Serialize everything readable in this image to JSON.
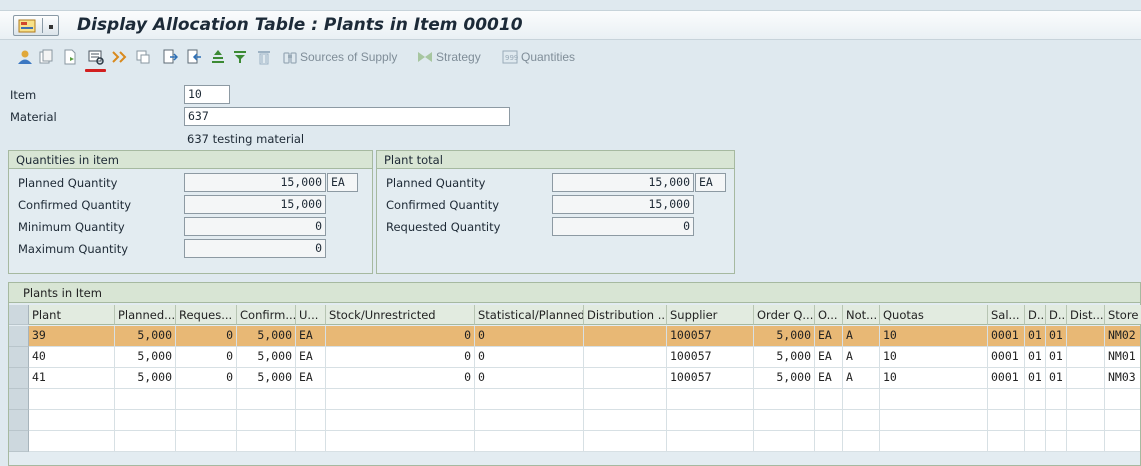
{
  "window": {
    "title": "Display Allocation Table : Plants in Item 00010"
  },
  "toolbar": {
    "sources_label": "Sources of Supply",
    "strategy_label": "Strategy",
    "quantities_label": "Quantities"
  },
  "header": {
    "item_label": "Item",
    "item_value": "10",
    "material_label": "Material",
    "material_value": "637",
    "material_desc": "637 testing material"
  },
  "qty_group": {
    "title": "Quantities in item",
    "planned_label": "Planned Quantity",
    "planned_value": "15,000",
    "planned_unit": "EA",
    "confirmed_label": "Confirmed Quantity",
    "confirmed_value": "15,000",
    "min_label": "Minimum Quantity",
    "min_value": "0",
    "max_label": "Maximum Quantity",
    "max_value": "0"
  },
  "plant_group": {
    "title": "Plant total",
    "planned_label": "Planned Quantity",
    "planned_value": "15,000",
    "planned_unit": "EA",
    "confirmed_label": "Confirmed Quantity",
    "confirmed_value": "15,000",
    "requested_label": "Requested Quantity",
    "requested_value": "0"
  },
  "table": {
    "title": "Plants in Item",
    "columns": [
      "Plant",
      "Planned...",
      "Reques...",
      "Confirm...",
      "U...",
      "Stock/Unrestricted",
      "Statistical/Planned",
      "Distribution ...",
      "Supplier",
      "Order Q...",
      "O...",
      "Not...",
      "Quotas",
      "Sal...",
      "D...",
      "D...",
      "Dist...",
      "Store"
    ],
    "rows": [
      [
        "39",
        "5,000",
        "0",
        "5,000",
        "EA",
        "0",
        "0",
        "",
        "100057",
        "5,000",
        "EA",
        "A",
        "10",
        "0001",
        "01",
        "01",
        "",
        "NM02"
      ],
      [
        "40",
        "5,000",
        "0",
        "5,000",
        "EA",
        "0",
        "0",
        "",
        "100057",
        "5,000",
        "EA",
        "A",
        "10",
        "0001",
        "01",
        "01",
        "",
        "NM01"
      ],
      [
        "41",
        "5,000",
        "0",
        "5,000",
        "EA",
        "0",
        "0",
        "",
        "100057",
        "5,000",
        "EA",
        "A",
        "10",
        "0001",
        "01",
        "01",
        "",
        "NM03"
      ]
    ]
  },
  "colors": {
    "selected_row": "#e8b875",
    "group_header": "#d8e5d4",
    "background": "#dfe9ef"
  }
}
